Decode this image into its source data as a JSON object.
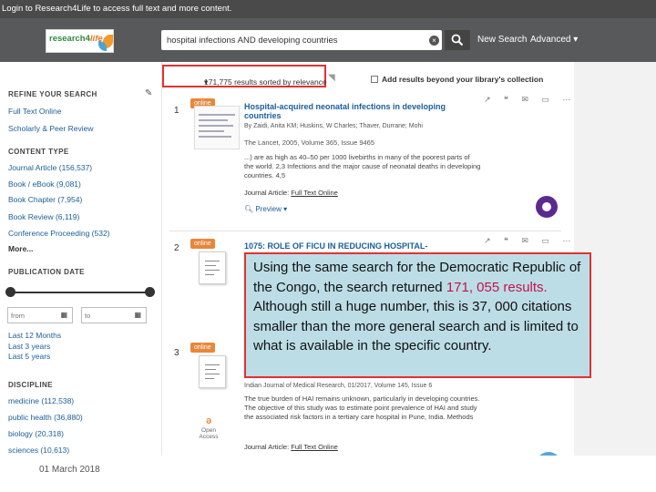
{
  "login_bar": {
    "text": "Login to Research4Life to access full text and more content."
  },
  "header": {
    "logo": {
      "research": "research",
      "four": "4",
      "life": "life"
    },
    "search_value": "hospital infections AND developing countries",
    "clear_icon": "close-circle-icon",
    "search_icon": "magnifier-icon",
    "new_search": "New Search",
    "advanced": "Advanced",
    "advanced_icon": "caret-down-icon"
  },
  "sidebar": {
    "refine_heading": "REFINE YOUR SEARCH",
    "edit_icon": "pencil-icon",
    "refine_items": [
      "Full Text Online",
      "Scholarly & Peer Review"
    ],
    "content_type_heading": "CONTENT TYPE",
    "content_types": [
      "Journal Article (156,537)",
      "Book / eBook (9,081)",
      "Book Chapter (7,954)",
      "Book Review (6,119)",
      "Conference Proceeding (532)"
    ],
    "more_label": "More...",
    "pub_date_heading": "PUBLICATION DATE",
    "from_placeholder": "from",
    "to_placeholder": "to",
    "date_ranges": [
      "Last 12 Months",
      "Last 3 years",
      "Last 5 years"
    ],
    "discipline_heading": "DISCIPLINE",
    "disciplines": [
      "medicine (112,538)",
      "public health (36,880)",
      "biology (20,318)",
      "sciences (10,613)"
    ]
  },
  "results_header": {
    "count_text": "171,775 results sorted by relevance",
    "sort_icon": "caret-down-icon",
    "rss_icon": "rss-icon",
    "add_results": "Add results beyond your library's collection"
  },
  "results": [
    {
      "number": "1",
      "badge": "online",
      "title": "Hospital-acquired neonatal infections in developing countries",
      "authors": "The Lancet, 2005, Volume 365, Issue 9465",
      "author_line": "By Zaidi, Anita KM; Huskins, W Charles; Thaver, Durrane; Mohi",
      "snippet": "...) are as high as 40–50 per 1000 livebirths in many of the poorest parts of the world. 2,3 Infections and the major cause of neonatal deaths in developing countries. 4,5",
      "type_label": "Journal Article:",
      "type_link": "Full Text Online",
      "preview": "Preview",
      "actions": "↗ ❝ ✉ ▭ ⋯"
    },
    {
      "number": "2",
      "badge": "online",
      "title": "1075: ROLE OF FICU IN REDUCING HOSPITAL-",
      "actions": "↗ ❝ ✉ ▭ ⋯"
    },
    {
      "number": "3",
      "badge": "online",
      "meta": "Indian Journal of Medical Research, 01/2017, Volume 145, Issue 6",
      "snippet": "The true burden of HAI remains unknown, particularly in developing countries. The objective of this study was to estimate point prevalence of HAI and study the associated risk factors in a tertiary care hospital in Pune, India. Methods",
      "type_label": "Journal Article:",
      "type_link": "Full Text Online",
      "open_access": "Open Access"
    }
  ],
  "callout": {
    "before": "Using the same search for the Democratic Republic of the Congo, the search returned ",
    "highlight": "171, 055 results.",
    "after": "  Although still a huge number, this is 37, 000 citations smaller than the more general search and is limited to what is available in the specific country."
  },
  "footer": {
    "date": "01 March 2018"
  },
  "colors": {
    "topbar": "#4a4a4a",
    "searchbar": "#58595b",
    "link": "#1a5e99",
    "online_badge": "#e8873a",
    "highlight_border": "#e53030",
    "callout_bg": "#bcdde6",
    "callout_highlight": "#c3134e"
  }
}
